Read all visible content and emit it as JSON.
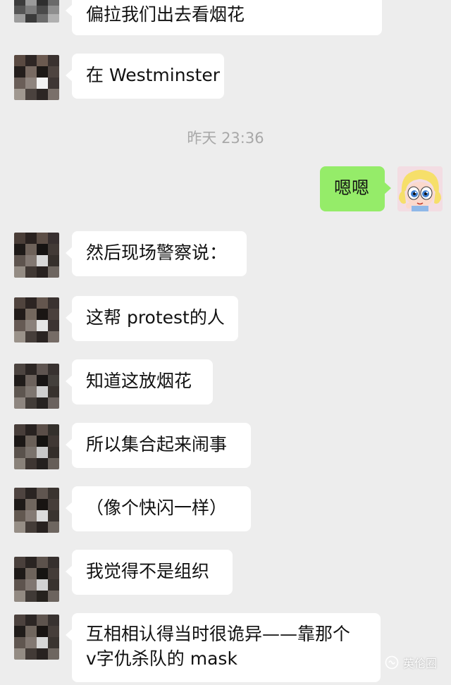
{
  "colors": {
    "background": "#ededed",
    "incoming_bubble": "#ffffff",
    "outgoing_bubble": "#95ec69",
    "timestamp_text": "#a8a8a8"
  },
  "messages": [
    {
      "text": "偏拉我们出去看烟花"
    },
    {
      "text": "在 Westminster"
    },
    {
      "timestamp": "昨天 23:36"
    },
    {
      "text": "嗯嗯"
    },
    {
      "text": "然后现场警察说："
    },
    {
      "text": "这帮 protest的人"
    },
    {
      "text": "知道这放烟花"
    },
    {
      "text": "所以集合起来闹事"
    },
    {
      "text": "（像个快闪一样）"
    },
    {
      "text": "我觉得不是组织"
    },
    {
      "line1": "互相相认得当时很诡异——靠那个",
      "line2": "v字仇杀队的 mask"
    }
  ],
  "watermark": {
    "icon": "wechat-channel-icon",
    "text": "英伦圈"
  }
}
